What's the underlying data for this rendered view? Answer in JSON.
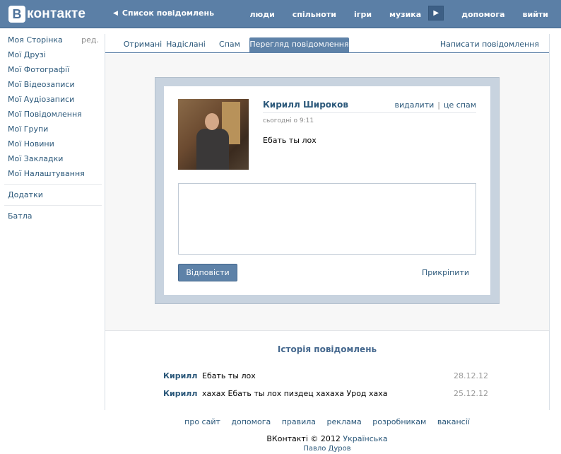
{
  "header": {
    "logo_letter": "В",
    "logo_text": "контакте",
    "back_label": "Список повідомлень",
    "nav": [
      "люди",
      "спільноти",
      "ігри",
      "музика"
    ],
    "help": "допомога",
    "logout": "вийти"
  },
  "sidebar": {
    "items": [
      {
        "label": "Моя Сторінка"
      },
      {
        "label": "Мої Друзі"
      },
      {
        "label": "Мої Фотографії"
      },
      {
        "label": "Мої Відеозаписи"
      },
      {
        "label": "Мої Аудіозаписи"
      },
      {
        "label": "Мої Повідомлення"
      },
      {
        "label": "Мої Групи"
      },
      {
        "label": "Мої Новини"
      },
      {
        "label": "Мої Закладки"
      },
      {
        "label": "Мої Налаштування"
      }
    ],
    "edit_label": "ред.",
    "apps": "Додатки",
    "extra": "Батла"
  },
  "tabs": {
    "received": "Отримані",
    "sent": "Надіслані",
    "spam": "Спам",
    "view": "Перегляд повідомлення",
    "write": "Написати повідомлення"
  },
  "message": {
    "sender": "Кирилл Широков",
    "delete": "видалити",
    "spam": "це спам",
    "time": "сьогодні о 9:11",
    "text": "Ебать ты лох",
    "reply_label": "Відповісти",
    "attach_label": "Прикріпити",
    "reply_value": ""
  },
  "history": {
    "title": "Історія повідомлень",
    "rows": [
      {
        "name": "Кирилл",
        "text": "Ебать ты лох",
        "date": "28.12.12"
      },
      {
        "name": "Кирилл",
        "text": "хахах Ебать ты лох пиздец хахаха Урод хаха",
        "date": "25.12.12"
      }
    ]
  },
  "footer": {
    "links": [
      "про сайт",
      "допомога",
      "правила",
      "реклама",
      "розробникам",
      "вакансії"
    ],
    "copyright": "ВКонтакті © 2012",
    "language": "Українська",
    "author": "Павло Дуров"
  },
  "colors": {
    "header_bg": "#5b7fa6",
    "link": "#2b587a",
    "active_tab": "#5e82a8"
  }
}
